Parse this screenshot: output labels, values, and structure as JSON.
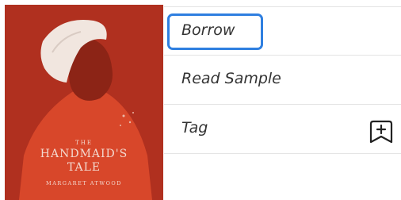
{
  "book": {
    "cover_the": "THE",
    "cover_title_line1": "HANDMAID'S",
    "cover_title_line2": "TALE",
    "cover_author": "MARGARET ATWOOD"
  },
  "actions": {
    "borrow": "Borrow",
    "read_sample": "Read Sample",
    "tag": "Tag"
  },
  "icons": {
    "tag_icon": "bookmark-plus-icon"
  },
  "colors": {
    "cover_red": "#b0301f",
    "focus_blue": "#2f7fe0"
  }
}
